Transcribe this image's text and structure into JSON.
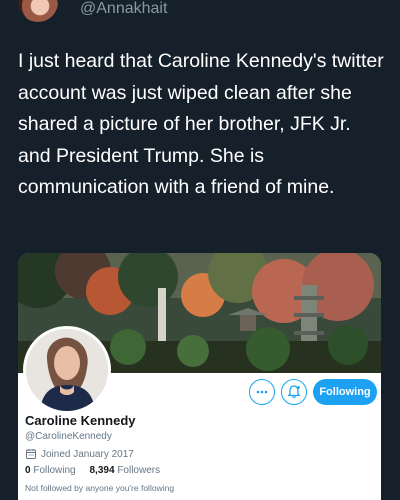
{
  "author": {
    "handle": "@Annakhait"
  },
  "tweet": {
    "text": "I just heard that Caroline Kennedy's twitter account was just wiped clean after she shared a picture of her brother, JFK Jr. and President Trump. She is communication with a friend of mine."
  },
  "profile_card": {
    "name": "Caroline Kennedy",
    "username": "@CarolineKennedy",
    "joined": "Joined January 2017",
    "following_count": "0",
    "following_label": "Following",
    "followers_count": "8,394",
    "followers_label": "Followers",
    "not_followed": "Not followed by anyone you're following",
    "following_button": "Following"
  },
  "icons": {
    "more": "more-icon",
    "notify": "bell-plus-icon",
    "calendar": "calendar-icon"
  },
  "colors": {
    "background": "#15202b",
    "accent": "#1da1f2",
    "handle": "#8899a6",
    "card": "#ffffff"
  }
}
